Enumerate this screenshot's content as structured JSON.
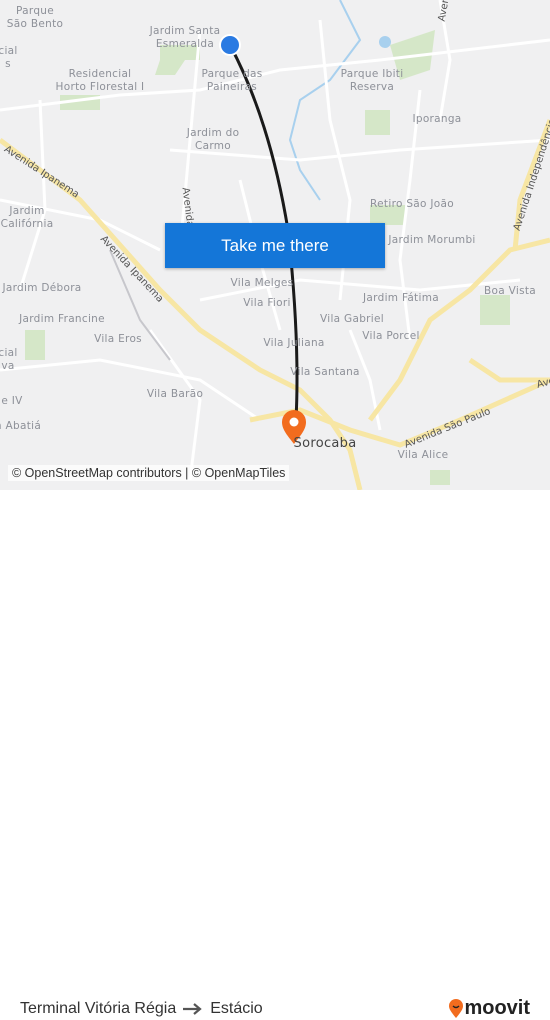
{
  "map": {
    "labels": [
      {
        "text": "Parque\nSão Bento"
      },
      {
        "text": "Jardim Santa\nEsmeralda"
      },
      {
        "text": "cial\ns"
      },
      {
        "text": "Residencial\nHorto Florestal I"
      },
      {
        "text": "Parque das\nPaineiras"
      },
      {
        "text": "Parque Ibiti\nReserva"
      },
      {
        "text": "Iporanga"
      },
      {
        "text": "Jardim do\nCarmo"
      },
      {
        "text": "Jardim\nCalifórnia"
      },
      {
        "text": "Retiro São João"
      },
      {
        "text": "Jardim Morumbi"
      },
      {
        "text": "Jardim Débora"
      },
      {
        "text": "Vila Melges"
      },
      {
        "text": "Vila Fiori"
      },
      {
        "text": "Jardim Fátima"
      },
      {
        "text": "Boa Vista"
      },
      {
        "text": "Jardim Francine"
      },
      {
        "text": "Vila Gabriel"
      },
      {
        "text": "Vila Porcel"
      },
      {
        "text": "Vila Eros"
      },
      {
        "text": "Vila Juliana"
      },
      {
        "text": "cial\nva"
      },
      {
        "text": "Vila Santana"
      },
      {
        "text": "Vila Barão"
      },
      {
        "text": "e IV"
      },
      {
        "text": "n Abatiá"
      },
      {
        "text": "Sorocaba"
      },
      {
        "text": "Vila Alice"
      }
    ],
    "roads": [
      "Avenida Ipanema",
      "Avenida Ipanema",
      "Avenida",
      "Avenida São Paulo",
      "Avenida",
      "Avenida Independência",
      "Avenida"
    ],
    "cta_label": "Take me there",
    "attribution": "© OpenStreetMap contributors | © OpenMapTiles",
    "colors": {
      "route": "#1a1a1a",
      "origin": "#2a7ae2",
      "destination": "#f26c1e",
      "cta": "#1476d8",
      "major_road": "#f7e6a4"
    }
  },
  "footer": {
    "origin": "Terminal Vitória Régia",
    "destination": "Estácio",
    "brand": "moovit"
  }
}
